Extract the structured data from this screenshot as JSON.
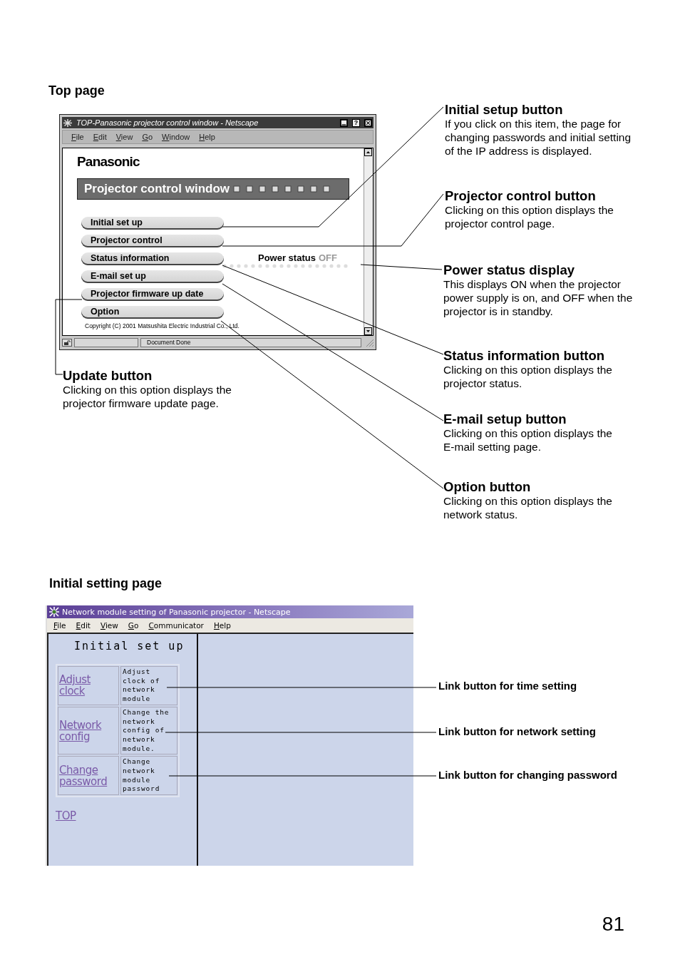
{
  "top_page": {
    "heading": "Top page",
    "window": {
      "title": "TOP-Panasonic projector control window - Netscape",
      "help_button": "?",
      "menu": [
        "File",
        "Edit",
        "View",
        "Go",
        "Window",
        "Help"
      ],
      "logo": "Panasonic",
      "banner": "Projector control window",
      "buttons": [
        "Initial set up",
        "Projector control",
        "Status information",
        "E-mail set up",
        "Projector firmware up date",
        "Option"
      ],
      "power_status": {
        "label": "Power status",
        "value": "OFF"
      },
      "copyright": "Copyright (C) 2001 Matsushita Electric Industrial Co., Ltd.",
      "status_bar": "Document Done"
    },
    "callouts": [
      {
        "title": "Initial setup button",
        "text": "If you click on this item, the page for changing passwords and initial setting of the IP address is displayed."
      },
      {
        "title": "Projector control button",
        "text": "Clicking on this option displays the projector control page."
      },
      {
        "title": "Power status display",
        "text": "This displays ON when the projector power supply is on, and OFF when the projector is in standby."
      },
      {
        "title": "Status information button",
        "text": "Clicking on this option displays the projector status."
      },
      {
        "title": "E-mail setup button",
        "text": "Clicking on this option displays the E-mail setting page."
      },
      {
        "title": "Option button",
        "text": "Clicking on this option displays the network status."
      },
      {
        "title": "Update button",
        "text": "Clicking on this option displays the projector firmware update page."
      }
    ]
  },
  "initial_setting_page": {
    "heading": "Initial setting page",
    "window": {
      "title": "Network module setting of Panasonic projector - Netscape",
      "menu": [
        "File",
        "Edit",
        "View",
        "Go",
        "Communicator",
        "Help"
      ],
      "panel_title": "Initial set up",
      "rows": [
        {
          "link": "Adjust clock",
          "description": "Adjust clock of network module"
        },
        {
          "link": "Network config",
          "description": "Change the network config of network module."
        },
        {
          "link": "Change password",
          "description": "Change network module password"
        }
      ],
      "top_link": "TOP"
    },
    "callouts": [
      "Link button for time setting",
      "Link button for network setting",
      "Link button for changing password"
    ]
  },
  "page_number": "81"
}
